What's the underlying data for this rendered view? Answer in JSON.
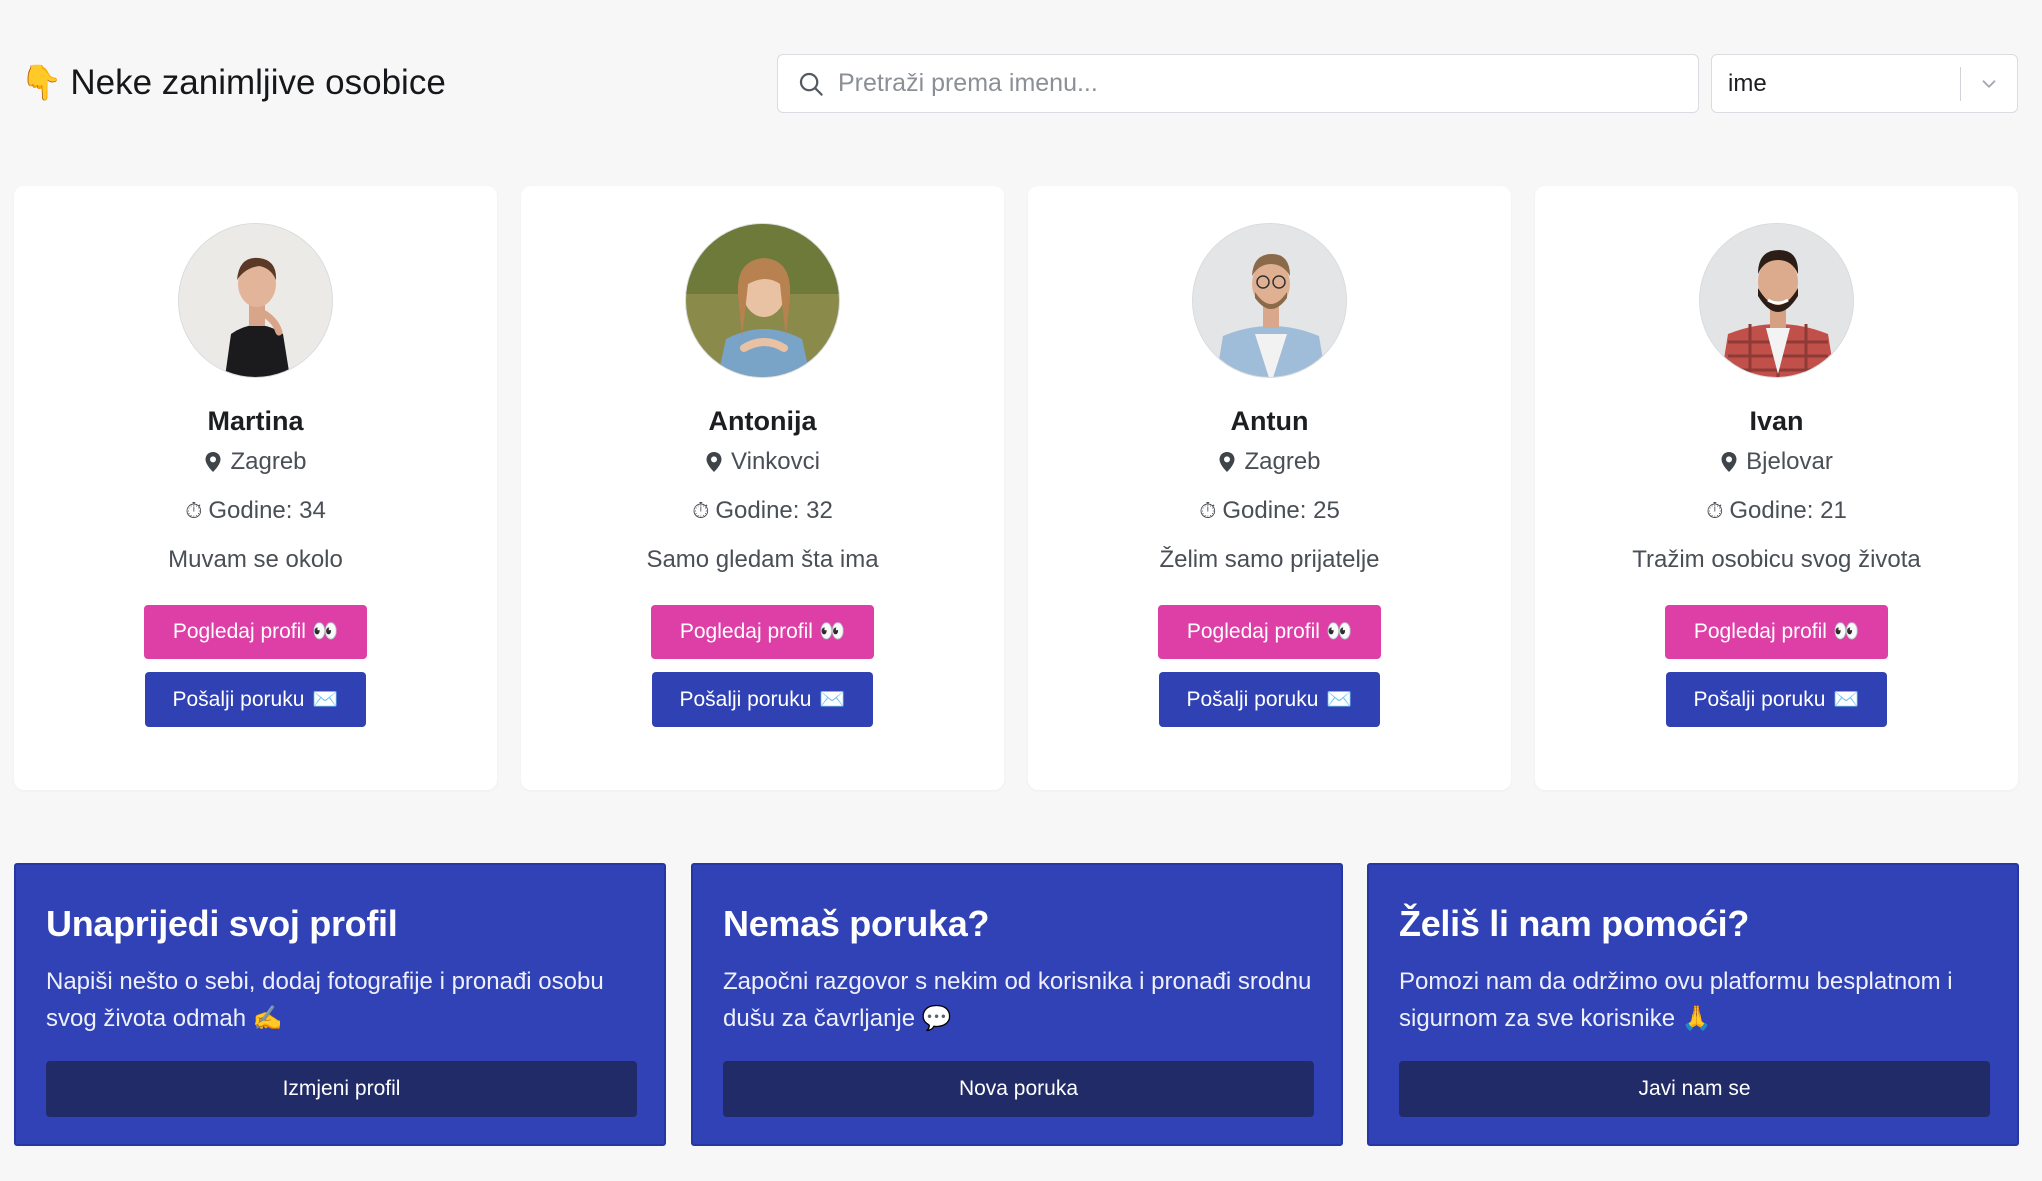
{
  "header": {
    "title_emoji": "👇",
    "title": "Neke zanimljive osobice",
    "search_placeholder": "Pretraži prema imenu...",
    "sort_value": "ime"
  },
  "profiles": [
    {
      "name": "Martina",
      "city": "Zagreb",
      "age_label": "Godine: 34",
      "bio": "Muvam se okolo",
      "view_label": "Pogledaj profil",
      "view_emoji": "👀",
      "msg_label": "Pošalji poruku",
      "msg_emoji": "✉️"
    },
    {
      "name": "Antonija",
      "city": "Vinkovci",
      "age_label": "Godine: 32",
      "bio": "Samo gledam šta ima",
      "view_label": "Pogledaj profil",
      "view_emoji": "👀",
      "msg_label": "Pošalji poruku",
      "msg_emoji": "✉️"
    },
    {
      "name": "Antun",
      "city": "Zagreb",
      "age_label": "Godine: 25",
      "bio": "Želim samo prijatelje",
      "view_label": "Pogledaj profil",
      "view_emoji": "👀",
      "msg_label": "Pošalji poruku",
      "msg_emoji": "✉️"
    },
    {
      "name": "Ivan",
      "city": "Bjelovar",
      "age_label": "Godine: 21",
      "bio": "Tražim osobicu svog života",
      "view_label": "Pogledaj profil",
      "view_emoji": "👀",
      "msg_label": "Pošalji poruku",
      "msg_emoji": "✉️"
    }
  ],
  "promos": [
    {
      "title": "Unaprijedi svoj profil",
      "text": "Napiši nešto o sebi, dodaj fotografije i pronađi osobu svog života odmah ✍️",
      "button": "Izmjeni profil"
    },
    {
      "title": "Nemaš poruka?",
      "text": "Započni razgovor s nekim od korisnika i pronađi srodnu dušu za čavrljanje 💬",
      "button": "Nova poruka"
    },
    {
      "title": "Želiš li nam pomoći?",
      "text": "Pomozi nam da održimo ovu platformu besplatnom i sigurnom za sve korisnike 🙏",
      "button": "Javi nam se"
    }
  ],
  "colors": {
    "accent_pink": "#de3fa6",
    "accent_blue": "#2f41b3",
    "promo_bg": "#3042b5",
    "promo_button": "#212b68"
  },
  "icons": {
    "title": "pointing-down-emoji",
    "search": "search-icon",
    "select": "chevron-down-icon",
    "location": "map-pin-icon",
    "age": "stopwatch-icon"
  }
}
